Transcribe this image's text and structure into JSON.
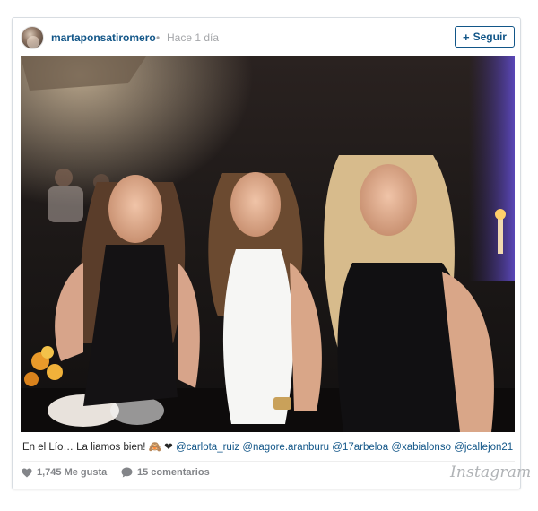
{
  "post": {
    "username": "martaponsatiromero",
    "separator": "•",
    "timestamp": "Hace 1 día",
    "follow_label": "Seguir",
    "follow_icon": "plus-icon",
    "caption": {
      "text": "En el Lío… La liamos bien! ",
      "emoji_1": "🙈",
      "emoji_2": "❤",
      "mentions": [
        "@carlota_ruiz",
        "@nagore.aranburu",
        "@17arbeloa",
        "@xabialonso",
        "@jcallejon21"
      ]
    },
    "likes": "1,745 Me gusta",
    "comments": "15 comentarios",
    "brand": "Instagram"
  },
  "colors": {
    "link": "#125688",
    "muted": "#a5a7aa",
    "stats": "#838589",
    "brand": "#b0b3b6"
  },
  "icons": [
    "heart-icon",
    "comment-bubble-icon",
    "plus-icon"
  ]
}
